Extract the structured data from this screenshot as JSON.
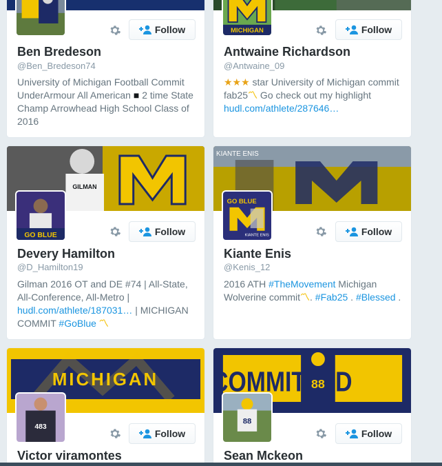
{
  "follow_label": "Follow",
  "cards": [
    {
      "name": "Ben Bredeson",
      "handle": "@Ben_Bredeson74",
      "bio": [
        "University of Michigan Football Commit UnderArmour All American ",
        "■",
        " 2 time State Champ Arrowhead High School Class of 2016"
      ]
    },
    {
      "name": "Antwaine Richardson",
      "handle": "@Antwaine_09",
      "bio": [
        "★★★",
        " star University of Michigan commit fab25",
        "〽",
        " Go check out my highlight ",
        "hudl.com/athlete/287646…"
      ]
    },
    {
      "name": "Devery Hamilton",
      "handle": "@D_Hamilton19",
      "bio": [
        "Gilman 2016 OT and DE #74 | All-State, All-Conference, All-Metro | ",
        "hudl.com/athlete/187031…",
        " | MICHIGAN COMMIT ",
        "#GoBlue",
        " ",
        "〽"
      ],
      "banner_text": "GILMAN",
      "avatar_text": "GO BLUE"
    },
    {
      "name": "Kiante Enis",
      "handle": "@Kenis_12",
      "bio": [
        "2016 ATH ",
        "#TheMovement",
        " Michigan Wolverine commit",
        "〽",
        ". ",
        "#Fab25",
        " . ",
        "#Blessed",
        " ."
      ],
      "banner_text": "KIANTE ENIS",
      "avatar_text": "GO BLUE",
      "avatar_subtext": "KIANTE ENIS"
    },
    {
      "name": "Victor viramontes",
      "banner_text": "MICHIGAN",
      "avatar_text": "483"
    },
    {
      "name": "Sean Mckeon",
      "banner_text": "COMMITTED",
      "avatar_text": "88"
    }
  ],
  "colors": {
    "maize": "#f2c500",
    "blue": "#1d2a66",
    "link": "#1b95e0",
    "text": "#292f33",
    "muted": "#66757f",
    "background": "#e6ecf0"
  },
  "icons": [
    "gear-icon",
    "follow-person-plus-icon"
  ]
}
